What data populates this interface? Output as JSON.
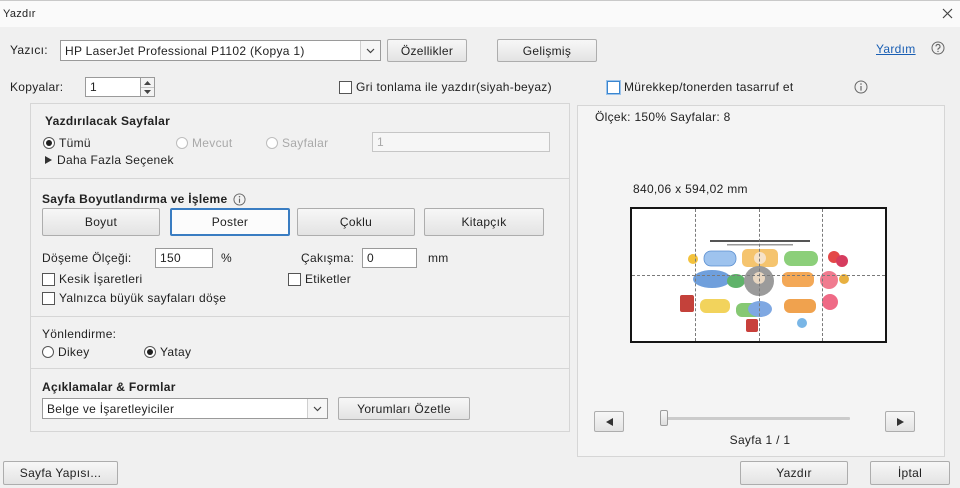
{
  "window": {
    "title": "Yazdır"
  },
  "printer": {
    "label": "Yazıcı:",
    "selected": "HP LaserJet Professional P1102 (Kopya 1)",
    "properties_label": "Özellikler",
    "advanced_label": "Gelişmiş"
  },
  "help": {
    "label": "Yardım"
  },
  "copies": {
    "label": "Kopyalar:",
    "value": "1"
  },
  "options": {
    "grayscale": {
      "label": "Gri tonlama ile yazdır(siyah-beyaz)",
      "checked": false
    },
    "save_ink": {
      "label": "Mürekkep/tonerden tasarruf et",
      "checked": false,
      "focused": true
    }
  },
  "pages_to_print": {
    "title": "Yazdırılacak Sayfalar",
    "options": [
      {
        "label": "Tümü",
        "selected": true,
        "enabled": true
      },
      {
        "label": "Mevcut",
        "selected": false,
        "enabled": false
      },
      {
        "label": "Sayfalar",
        "selected": false,
        "enabled": false
      }
    ],
    "pages_value": "1",
    "pages_field_enabled": false,
    "more_options": "Daha Fazla Seçenek"
  },
  "sizing": {
    "title": "Sayfa Boyutlandırma ve İşleme",
    "modes": [
      {
        "label": "Boyut",
        "selected": false
      },
      {
        "label": "Poster",
        "selected": true
      },
      {
        "label": "Çoklu",
        "selected": false
      },
      {
        "label": "Kitapçık",
        "selected": false
      }
    ],
    "tile_scale_label": "Döşeme Ölçeği:",
    "tile_scale_value": "150",
    "tile_scale_unit": "%",
    "overlap_label": "Çakışma:",
    "overlap_value": "0",
    "overlap_unit": "mm",
    "cut_marks": {
      "label": "Kesik İşaretleri",
      "checked": false
    },
    "labels": {
      "label": "Etiketler",
      "checked": false
    },
    "tile_large_only": {
      "label": "Yalnızca büyük sayfaları döşe",
      "checked": false
    }
  },
  "orientation": {
    "title": "Yönlendirme:",
    "options": [
      {
        "label": "Dikey",
        "selected": false
      },
      {
        "label": "Yatay",
        "selected": true
      }
    ]
  },
  "comments_forms": {
    "title": "Açıklamalar & Formlar",
    "selected": "Belge ve İşaretleyiciler",
    "summarize_label": "Yorumları Özetle"
  },
  "preview": {
    "scale_text": "Ölçek: 150% Sayfalar: 8",
    "paper_size": "840,06 x 594,02 mm",
    "page_indicator": "Sayfa 1 / 1",
    "tiles": {
      "columns": 4,
      "rows": 2
    },
    "slider_value": 0
  },
  "footer": {
    "page_setup_label": "Sayfa Yapısı...",
    "print_label": "Yazdır",
    "cancel_label": "İptal"
  },
  "icons": {
    "close": "close-icon",
    "help": "help-icon",
    "info": "info-icon",
    "dropdown": "chevron-down-icon",
    "disclosure": "disclosure-triangle-icon",
    "spin_up": "spin-up-icon",
    "spin_down": "spin-down-icon",
    "prev": "previous-page-icon",
    "next": "next-page-icon"
  },
  "colors": {
    "accent": "#3a7dc2",
    "link": "#1a5fb4",
    "focus": "#3a86d0"
  }
}
